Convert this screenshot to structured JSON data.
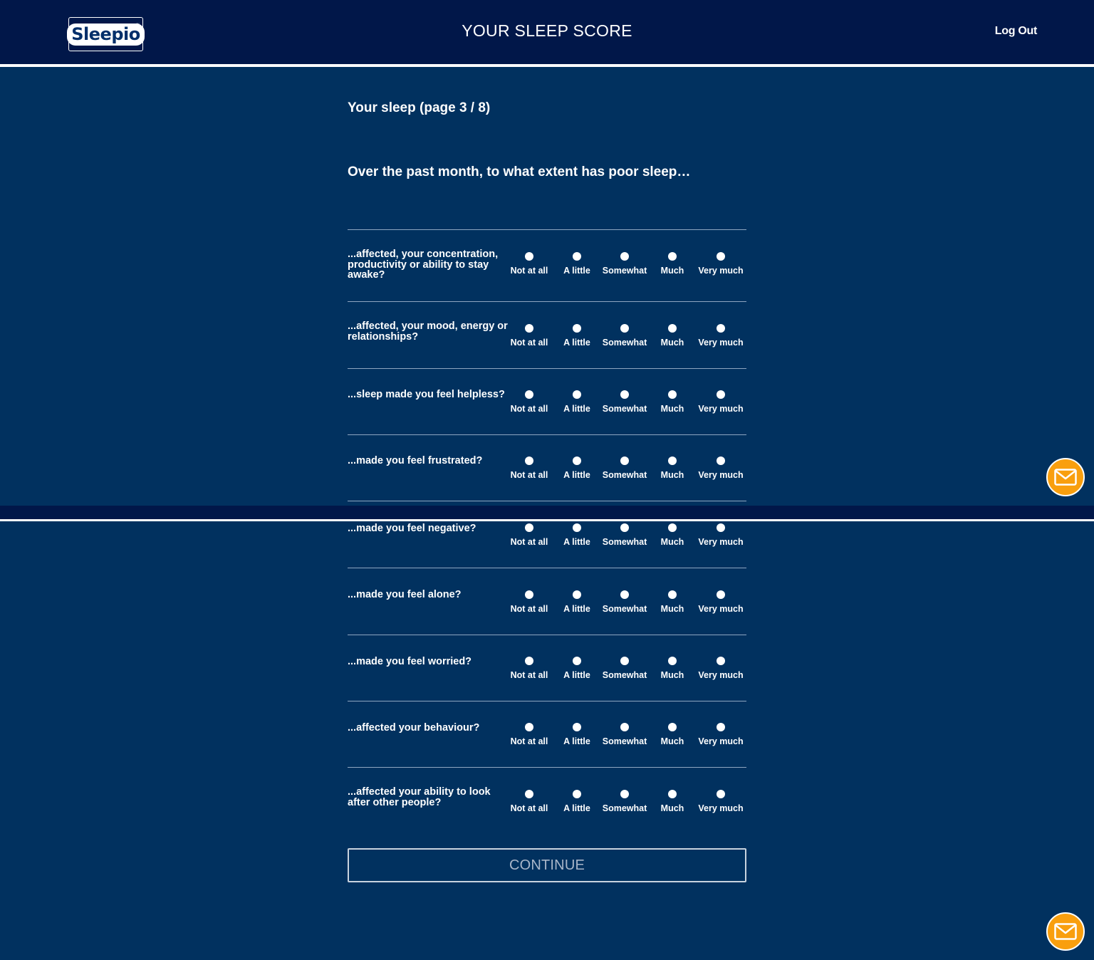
{
  "header": {
    "logo_text": "Sleepio",
    "title": "YOUR SLEEP SCORE",
    "logout_label": "Log Out"
  },
  "main": {
    "page_title": "Your sleep (page 3 / 8)",
    "question_intro": "Over the past month, to what extent has poor sleep…",
    "options": [
      "Not at all",
      "A little",
      "Somewhat",
      "Much",
      "Very much"
    ],
    "questions": [
      {
        "label": "...affected, your concentration, productivity or ability to stay awake?"
      },
      {
        "label": "...affected, your mood, energy or relationships?"
      },
      {
        "label": "...sleep made you feel helpless?"
      },
      {
        "label": "...made you feel frustrated?"
      },
      {
        "label": "...made you feel negative?"
      },
      {
        "label": "...made you feel alone?"
      },
      {
        "label": "...made you feel worried?"
      },
      {
        "label": "...affected your behaviour?"
      },
      {
        "label": "...affected your ability to look after other people?"
      }
    ],
    "continue_label": "CONTINUE"
  },
  "colors": {
    "background": "#01315f",
    "header": "#011749",
    "accent": "#f99f0e"
  },
  "icons": {
    "contact": "mail-icon"
  }
}
